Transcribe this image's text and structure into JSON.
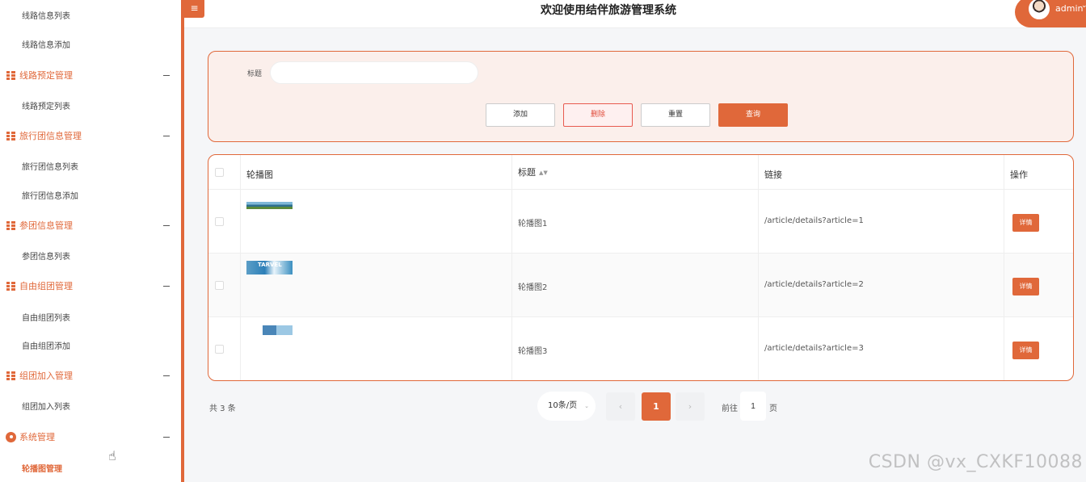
{
  "header": {
    "menu_toggle": "≡",
    "title": "欢迎使用结伴旅游管理系统",
    "user": "admin",
    "user_caret": "⌄"
  },
  "sidebar": {
    "items": [
      {
        "type": "sub",
        "label": "线路信息列表"
      },
      {
        "type": "sub",
        "label": "线路信息添加"
      },
      {
        "type": "group",
        "label": "线路预定管理"
      },
      {
        "type": "sub",
        "label": "线路预定列表"
      },
      {
        "type": "group",
        "label": "旅行团信息管理"
      },
      {
        "type": "sub",
        "label": "旅行团信息列表"
      },
      {
        "type": "sub",
        "label": "旅行团信息添加"
      },
      {
        "type": "group",
        "label": "参团信息管理"
      },
      {
        "type": "sub",
        "label": "参团信息列表"
      },
      {
        "type": "group",
        "label": "自由组团管理"
      },
      {
        "type": "sub",
        "label": "自由组团列表"
      },
      {
        "type": "sub",
        "label": "自由组团添加"
      },
      {
        "type": "group",
        "label": "组团加入管理"
      },
      {
        "type": "sub",
        "label": "组团加入列表"
      },
      {
        "type": "group",
        "label": "系统管理"
      },
      {
        "type": "sub",
        "label": "轮播图管理",
        "active": true
      }
    ]
  },
  "search": {
    "title_label": "标题",
    "title_value": "",
    "add_label": "添加",
    "delete_label": "删除",
    "reset_label": "重置",
    "query_label": "查询"
  },
  "table": {
    "columns": [
      "轮播图",
      "标题",
      "链接",
      "操作"
    ],
    "rows": [
      {
        "image_text": "",
        "title": "轮播图1",
        "link": "/article/details?article=1",
        "action": "详情"
      },
      {
        "image_text": "TARVEL",
        "title": "轮播图2",
        "link": "/article/details?article=2",
        "action": "详情"
      },
      {
        "image_text": "",
        "title": "轮播图3",
        "link": "/article/details?article=3",
        "action": "详情"
      }
    ]
  },
  "pagination": {
    "total": "共 3 条",
    "page_size": "10条/页",
    "prev": "‹",
    "current": "1",
    "next": "›",
    "goto_label": "前往",
    "goto_value": "1",
    "goto_unit": "页"
  },
  "watermark": "CSDN @vx_CXKF10088",
  "colors": {
    "accent": "#e0683a",
    "panel_bg": "#fbefeb",
    "delete_text": "#e04b3a"
  }
}
